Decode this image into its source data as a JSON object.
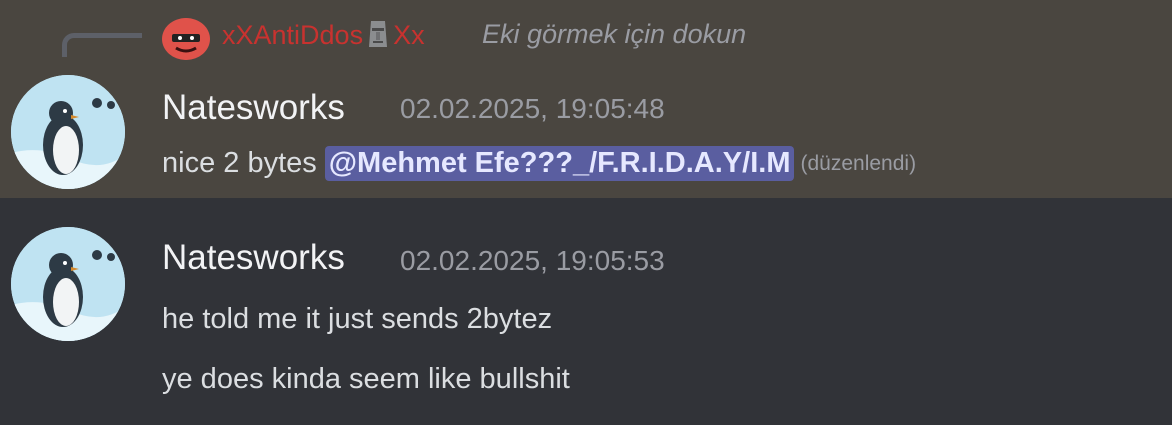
{
  "reply": {
    "author": "xXAntiDdos",
    "author_suffix": "Xx",
    "preview": "Eki görmek için dokun",
    "author_color": "#c8322f"
  },
  "messages": [
    {
      "author": "Natesworks",
      "timestamp": "02.02.2025, 19:05:48",
      "text_prefix": "nice 2 bytes",
      "mention": "@Mehmet Efe???_/F.R.I.D.A.Y/I.M",
      "edited": "(düzenlendi)"
    },
    {
      "author": "Natesworks",
      "timestamp": "02.02.2025, 19:05:53",
      "lines": [
        "he told me it just sends 2bytez",
        "ye does kinda seem like bullshit"
      ]
    }
  ],
  "colors": {
    "highlight_bg": "#4a4640",
    "chat_bg": "#313338",
    "mention_bg": "#5a5ea0"
  }
}
